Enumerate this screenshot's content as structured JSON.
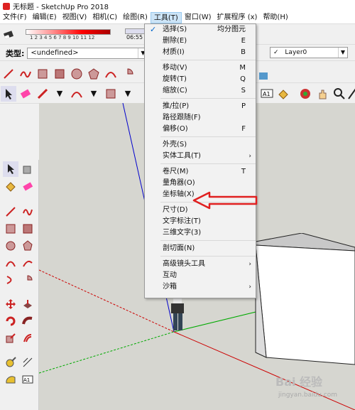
{
  "window": {
    "title": "无标题 - SketchUp Pro 2018"
  },
  "menubar": [
    {
      "label": "文件(F)"
    },
    {
      "label": "编辑(E)"
    },
    {
      "label": "视图(V)"
    },
    {
      "label": "相机(C)"
    },
    {
      "label": "绘图(R)"
    },
    {
      "label": "工具(T)"
    },
    {
      "label": "窗口(W)"
    },
    {
      "label": "扩展程序 (x)"
    },
    {
      "label": "帮助(H)"
    }
  ],
  "shadow": {
    "ticks": "1 2 3 4 5 6 7 8 9 10 11 12",
    "time": "06:55"
  },
  "entity": {
    "type_label": "类型:",
    "type_value": "<undefined>"
  },
  "layer": {
    "check": "✓",
    "value": "Layer0"
  },
  "tools_menu": {
    "items": [
      {
        "label": "选择(S)",
        "shortcut": "均分图元",
        "checked": true
      },
      {
        "label": "删除(E)",
        "shortcut": "E"
      },
      {
        "label": "材质(I)",
        "shortcut": "B"
      },
      {
        "sep": true
      },
      {
        "label": "移动(V)",
        "shortcut": "M"
      },
      {
        "label": "旋转(T)",
        "shortcut": "Q"
      },
      {
        "label": "缩放(C)",
        "shortcut": "S"
      },
      {
        "sep": true
      },
      {
        "label": "推/拉(P)",
        "shortcut": "P"
      },
      {
        "label": "路径跟随(F)",
        "shortcut": ""
      },
      {
        "label": "偏移(O)",
        "shortcut": "F"
      },
      {
        "sep": true
      },
      {
        "label": "外壳(S)",
        "shortcut": ""
      },
      {
        "label": "实体工具(T)",
        "shortcut": "",
        "submenu": true
      },
      {
        "sep": true
      },
      {
        "label": "卷尺(M)",
        "shortcut": "T"
      },
      {
        "label": "量角器(O)",
        "shortcut": ""
      },
      {
        "label": "坐标轴(X)",
        "shortcut": ""
      },
      {
        "sep": true
      },
      {
        "label": "尺寸(D)",
        "shortcut": ""
      },
      {
        "label": "文字标注(T)",
        "shortcut": ""
      },
      {
        "label": "三维文字(3)",
        "shortcut": ""
      },
      {
        "sep": true
      },
      {
        "label": "剖切面(N)",
        "shortcut": ""
      },
      {
        "sep": true
      },
      {
        "label": "高级镜头工具",
        "shortcut": "",
        "submenu": true
      },
      {
        "label": "互动",
        "shortcut": ""
      },
      {
        "label": "沙箱",
        "shortcut": "",
        "submenu": true
      }
    ]
  },
  "watermark": {
    "brand": "Bai 经验",
    "url": "jingyan.baidu.com"
  },
  "colors": {
    "accent": "#cce4f7",
    "annotation": "#e02020",
    "axis_red": "#cc0000",
    "axis_green": "#00aa00",
    "axis_blue": "#0000cc"
  }
}
